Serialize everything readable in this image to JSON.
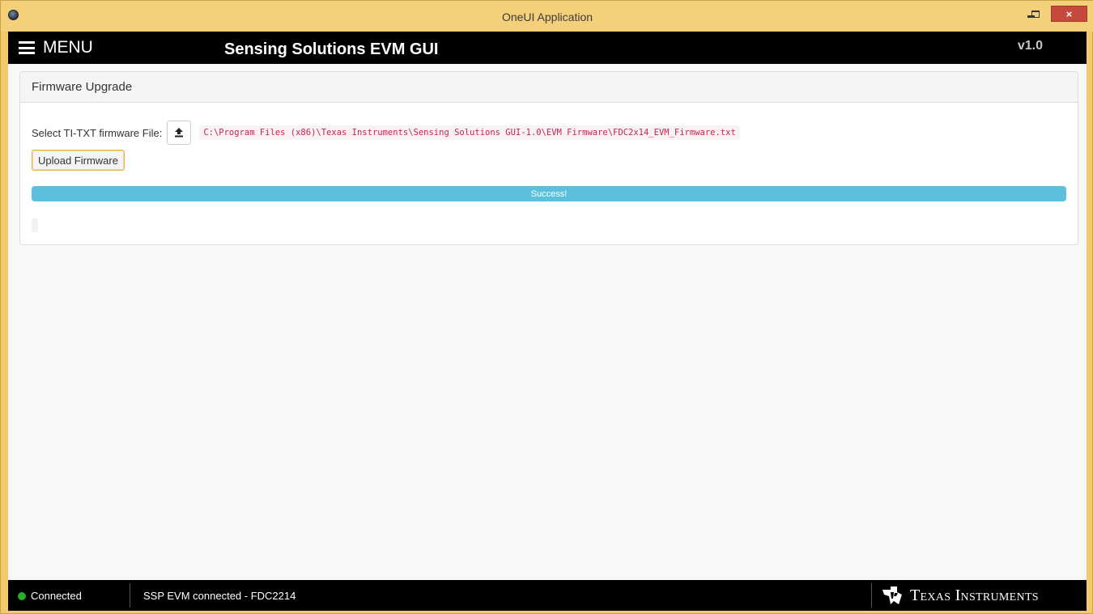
{
  "window": {
    "title": "OneUI Application",
    "close_glyph": "×"
  },
  "header": {
    "menu_label": "MENU",
    "app_title": "Sensing Solutions EVM GUI",
    "version": "v1.0"
  },
  "panel": {
    "heading": "Firmware Upgrade",
    "file_label": "Select TI-TXT firmware File:",
    "file_path": "C:\\Program Files (x86)\\Texas Instruments\\Sensing Solutions GUI-1.0\\EVM Firmware\\FDC2x14_EVM_Firmware.txt",
    "upload_button": "Upload Firmware",
    "progress_text": "Success!",
    "progress_percent": 100
  },
  "status": {
    "connection": "Connected",
    "message": "SSP EVM connected - FDC2214",
    "logo_text": "Texas Instruments"
  },
  "colors": {
    "titlebar": "#f5d07a",
    "progress": "#5bc0de",
    "connected_dot": "#27b027",
    "path_text": "#c7254e"
  },
  "icons": {
    "app": "app-icon",
    "menu": "hamburger-icon",
    "upload": "upload-icon",
    "logo": "ti-logo-icon"
  }
}
